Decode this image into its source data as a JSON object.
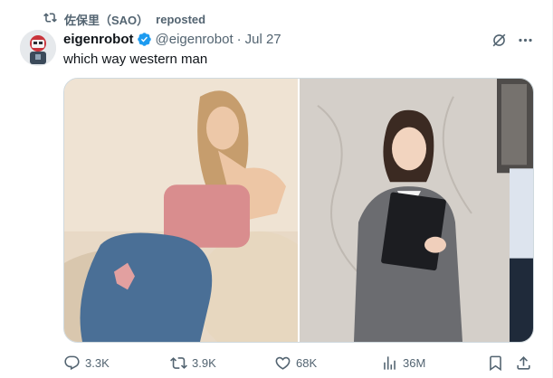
{
  "repost": {
    "icon": "repost-icon",
    "user": "佐保里（SAO）",
    "label": "reposted"
  },
  "author": {
    "name": "eigenrobot",
    "handle": "@eigenrobot",
    "separator": "·",
    "date": "Jul 27",
    "verified_icon": "verified-badge-icon"
  },
  "tweet": {
    "text": "which way western man"
  },
  "media": {
    "images": [
      "left-photo",
      "right-photo"
    ]
  },
  "actions": {
    "reply": {
      "icon": "reply-icon",
      "count": "3.3K"
    },
    "retweet": {
      "icon": "retweet-icon",
      "count": "3.9K"
    },
    "like": {
      "icon": "heart-icon",
      "count": "68K"
    },
    "views": {
      "icon": "analytics-icon",
      "count": "36M"
    },
    "bookmark": {
      "icon": "bookmark-icon"
    },
    "share": {
      "icon": "share-icon"
    }
  },
  "colors": {
    "text": "#0f1419",
    "secondary": "#536471",
    "verified": "#1d9bf0",
    "border": "#cfd9de"
  }
}
